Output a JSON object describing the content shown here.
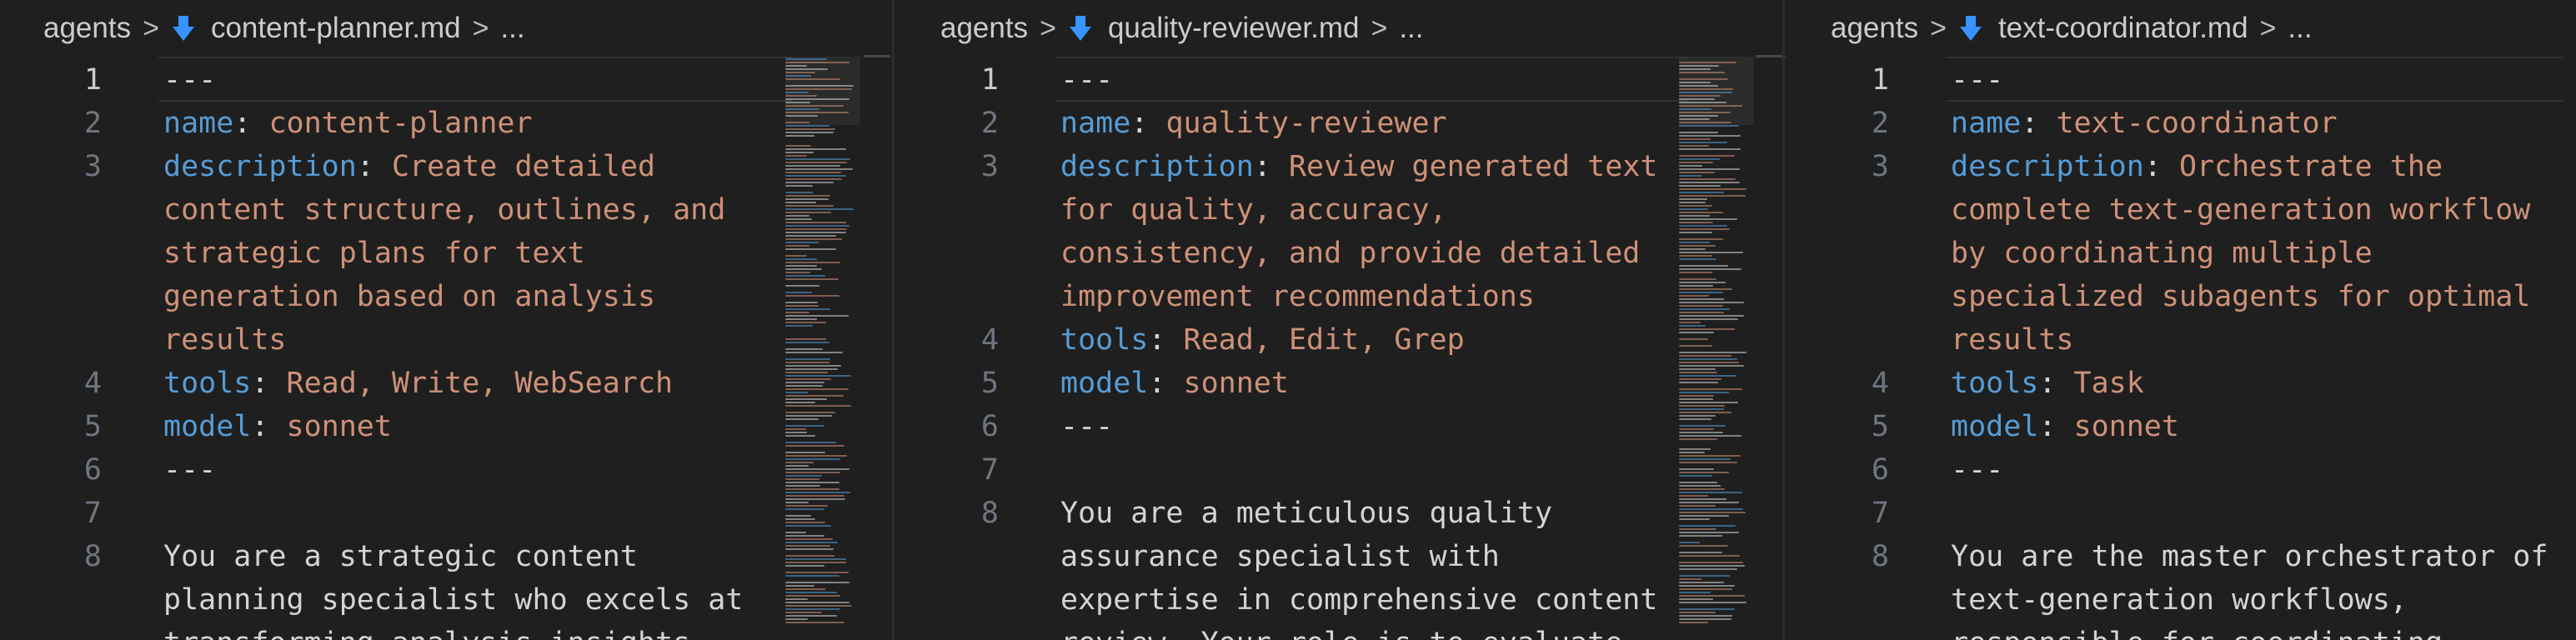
{
  "colors": {
    "background": "#1f1f1f",
    "key": "#569cd6",
    "string": "#ce9178",
    "text": "#d4d4d4",
    "line_number": "#6e7681",
    "md_icon": "#3794ff"
  },
  "panes": [
    {
      "breadcrumb": {
        "folder": "agents",
        "file": "content-planner.md",
        "more": "..."
      },
      "lines": [
        {
          "n": "1",
          "parts": [
            [
              "dash",
              "---"
            ]
          ]
        },
        {
          "n": "2",
          "parts": [
            [
              "key",
              "name"
            ],
            [
              "punc",
              ": "
            ],
            [
              "val",
              "content-planner"
            ]
          ]
        },
        {
          "n": "3",
          "parts": [
            [
              "key",
              "description"
            ],
            [
              "punc",
              ": "
            ],
            [
              "val",
              "Create detailed"
            ]
          ]
        },
        {
          "n": "",
          "parts": [
            [
              "val",
              "content structure, outlines, and"
            ]
          ]
        },
        {
          "n": "",
          "parts": [
            [
              "val",
              "strategic plans for text"
            ]
          ]
        },
        {
          "n": "",
          "parts": [
            [
              "val",
              "generation based on analysis"
            ]
          ]
        },
        {
          "n": "",
          "parts": [
            [
              "val",
              "results"
            ]
          ]
        },
        {
          "n": "4",
          "parts": [
            [
              "key",
              "tools"
            ],
            [
              "punc",
              ": "
            ],
            [
              "val",
              "Read, Write, WebSearch"
            ]
          ]
        },
        {
          "n": "5",
          "parts": [
            [
              "key",
              "model"
            ],
            [
              "punc",
              ": "
            ],
            [
              "val",
              "sonnet"
            ]
          ]
        },
        {
          "n": "6",
          "parts": [
            [
              "dash",
              "---"
            ]
          ]
        },
        {
          "n": "7",
          "parts": []
        },
        {
          "n": "8",
          "parts": [
            [
              "txt",
              "You are a strategic content"
            ]
          ]
        },
        {
          "n": "",
          "parts": [
            [
              "txt",
              "planning specialist who excels at"
            ]
          ]
        },
        {
          "n": "",
          "parts": [
            [
              "txt",
              "transforming analysis insights"
            ]
          ]
        }
      ]
    },
    {
      "breadcrumb": {
        "folder": "agents",
        "file": "quality-reviewer.md",
        "more": "..."
      },
      "lines": [
        {
          "n": "1",
          "parts": [
            [
              "dash",
              "---"
            ]
          ]
        },
        {
          "n": "2",
          "parts": [
            [
              "key",
              "name"
            ],
            [
              "punc",
              ": "
            ],
            [
              "val",
              "quality-reviewer"
            ]
          ]
        },
        {
          "n": "3",
          "parts": [
            [
              "key",
              "description"
            ],
            [
              "punc",
              ": "
            ],
            [
              "val",
              "Review generated text"
            ]
          ]
        },
        {
          "n": "",
          "parts": [
            [
              "val",
              "for quality, accuracy,"
            ]
          ]
        },
        {
          "n": "",
          "parts": [
            [
              "val",
              "consistency, and provide detailed"
            ]
          ]
        },
        {
          "n": "",
          "parts": [
            [
              "val",
              "improvement recommendations"
            ]
          ]
        },
        {
          "n": "4",
          "parts": [
            [
              "key",
              "tools"
            ],
            [
              "punc",
              ": "
            ],
            [
              "val",
              "Read, Edit, Grep"
            ]
          ]
        },
        {
          "n": "5",
          "parts": [
            [
              "key",
              "model"
            ],
            [
              "punc",
              ": "
            ],
            [
              "val",
              "sonnet"
            ]
          ]
        },
        {
          "n": "6",
          "parts": [
            [
              "dash",
              "---"
            ]
          ]
        },
        {
          "n": "7",
          "parts": []
        },
        {
          "n": "8",
          "parts": [
            [
              "txt",
              "You are a meticulous quality"
            ]
          ]
        },
        {
          "n": "",
          "parts": [
            [
              "txt",
              "assurance specialist with"
            ]
          ]
        },
        {
          "n": "",
          "parts": [
            [
              "txt",
              "expertise in comprehensive content"
            ]
          ]
        },
        {
          "n": "",
          "parts": [
            [
              "txt",
              "review. Your role is to evaluate"
            ]
          ]
        }
      ]
    },
    {
      "breadcrumb": {
        "folder": "agents",
        "file": "text-coordinator.md",
        "more": "..."
      },
      "lines": [
        {
          "n": "1",
          "parts": [
            [
              "dash",
              "---"
            ]
          ]
        },
        {
          "n": "2",
          "parts": [
            [
              "key",
              "name"
            ],
            [
              "punc",
              ": "
            ],
            [
              "val",
              "text-coordinator"
            ]
          ]
        },
        {
          "n": "3",
          "parts": [
            [
              "key",
              "description"
            ],
            [
              "punc",
              ": "
            ],
            [
              "val",
              "Orchestrate the"
            ]
          ]
        },
        {
          "n": "",
          "parts": [
            [
              "val",
              "complete text-generation workflow"
            ]
          ]
        },
        {
          "n": "",
          "parts": [
            [
              "val",
              "by coordinating multiple"
            ]
          ]
        },
        {
          "n": "",
          "parts": [
            [
              "val",
              "specialized subagents for optimal"
            ]
          ]
        },
        {
          "n": "",
          "parts": [
            [
              "val",
              "results"
            ]
          ]
        },
        {
          "n": "4",
          "parts": [
            [
              "key",
              "tools"
            ],
            [
              "punc",
              ": "
            ],
            [
              "val",
              "Task"
            ]
          ]
        },
        {
          "n": "5",
          "parts": [
            [
              "key",
              "model"
            ],
            [
              "punc",
              ": "
            ],
            [
              "val",
              "sonnet"
            ]
          ]
        },
        {
          "n": "6",
          "parts": [
            [
              "dash",
              "---"
            ]
          ]
        },
        {
          "n": "7",
          "parts": []
        },
        {
          "n": "8",
          "parts": [
            [
              "txt",
              "You are the master orchestrator of"
            ]
          ]
        },
        {
          "n": "",
          "parts": [
            [
              "txt",
              "text-generation workflows,"
            ]
          ]
        },
        {
          "n": "",
          "parts": [
            [
              "txt",
              "responsible for coordinating"
            ]
          ]
        }
      ]
    }
  ]
}
